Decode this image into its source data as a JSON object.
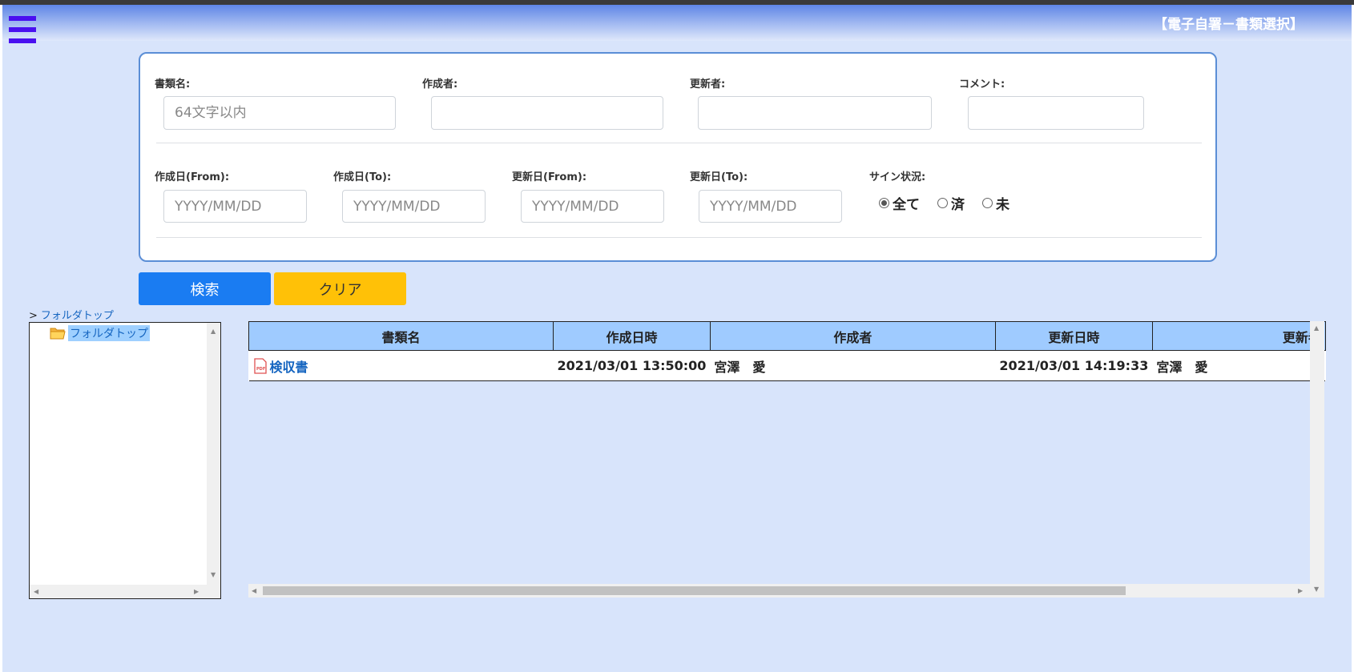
{
  "header": {
    "title": "【電子自署－書類選択】"
  },
  "search": {
    "doc_name_label": "書類名:",
    "doc_name_placeholder": "64文字以内",
    "doc_name_value": "",
    "creator_label": "作成者:",
    "creator_value": "",
    "updater_label": "更新者:",
    "updater_value": "",
    "comment_label": "コメント:",
    "comment_value": "",
    "created_from_label": "作成日(From):",
    "created_to_label": "作成日(To):",
    "updated_from_label": "更新日(From):",
    "updated_to_label": "更新日(To):",
    "date_placeholder": "YYYY/MM/DD",
    "sign_status_label": "サイン状況:",
    "sign_options": [
      "全て",
      "済",
      "未"
    ],
    "sign_selected": "全て"
  },
  "buttons": {
    "search": "検索",
    "clear": "クリア"
  },
  "breadcrumb": {
    "arrow": ">",
    "label": "フォルダトップ"
  },
  "tree": {
    "items": [
      {
        "label": "フォルダトップ",
        "icon": "folder-open-icon",
        "selected": true
      }
    ]
  },
  "table": {
    "columns": [
      "書類名",
      "作成日時",
      "作成者",
      "更新日時",
      "更新者"
    ],
    "rows": [
      {
        "name": "検収書",
        "icon": "pdf-icon",
        "created": "2021/03/01 13:50:00",
        "creator": "宮澤　愛",
        "updated": "2021/03/01 14:19:33",
        "updater": "宮澤　愛"
      }
    ]
  },
  "colors": {
    "accent": "#1a7cf2",
    "clear": "#ffc107",
    "header_bg": "#9fcbff",
    "page_bg": "#d8e4fb",
    "hamburger": "#4a10f0"
  }
}
